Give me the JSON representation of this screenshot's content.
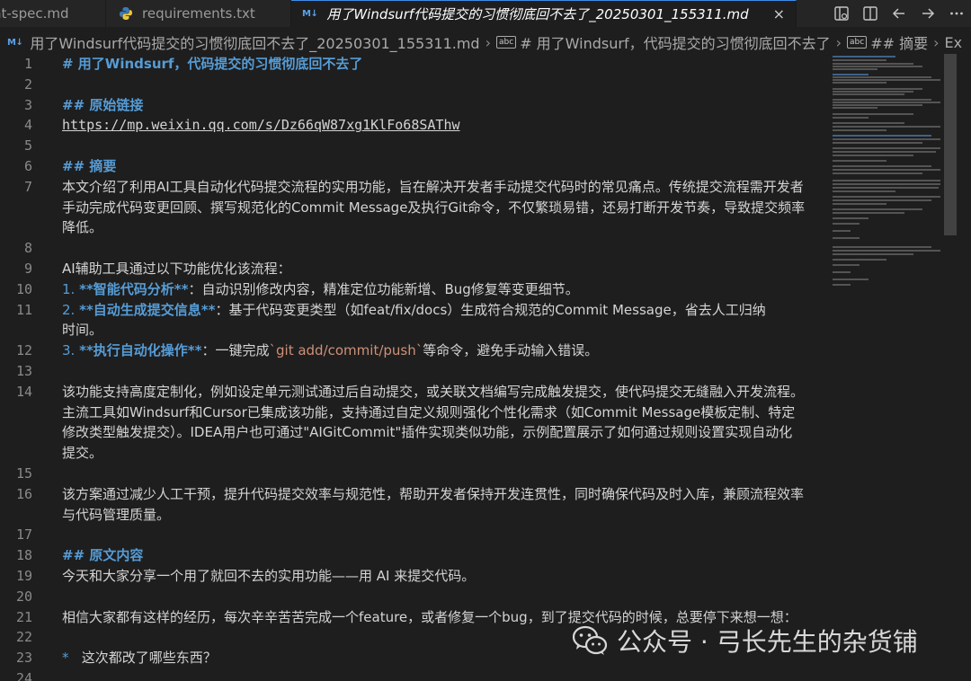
{
  "tabs": [
    {
      "label": "nt-spec.md",
      "type": "md"
    },
    {
      "label": "requirements.txt",
      "type": "py"
    },
    {
      "label": "用了Windsurf代码提交的习惯彻底回不去了_20250301_155311.md",
      "type": "md",
      "active": true,
      "close": "×"
    }
  ],
  "md_icon": "M↓",
  "breadcrumb": {
    "file": "用了Windsurf代码提交的习惯彻底回不去了_20250301_155311.md",
    "heading1": "# 用了Windsurf，代码提交的习惯彻底回不去了",
    "heading2": "## 摘要",
    "overflow": "Ex",
    "abc": "abc"
  },
  "lines": [
    {
      "n": "1",
      "parts": [
        {
          "t": "# 用了Windsurf，代码提交的习惯彻底回不去了",
          "c": "heading"
        }
      ]
    },
    {
      "n": "2",
      "parts": []
    },
    {
      "n": "3",
      "parts": [
        {
          "t": "## 原始链接",
          "c": "heading"
        }
      ]
    },
    {
      "n": "4",
      "parts": [
        {
          "t": "https://mp.weixin.qq.com/s/Dz66qW87xg1KlFo68SAThw",
          "c": "link"
        }
      ]
    },
    {
      "n": "5",
      "parts": []
    },
    {
      "n": "6",
      "parts": [
        {
          "t": "## 摘要",
          "c": "heading"
        }
      ]
    },
    {
      "n": "7",
      "parts": [
        {
          "t": "本文介绍了利用AI工具自动化代码提交流程的实用功能，旨在解决开发者手动提交代码时的常见痛点。传统提交流程需开发者",
          "c": ""
        }
      ]
    },
    {
      "n": "",
      "parts": [
        {
          "t": "手动完成代码变更回顾、撰写规范化的Commit Message及执行Git命令，不仅繁琐易错，还易打断开发节奏，导致提交频率",
          "c": ""
        }
      ]
    },
    {
      "n": "",
      "parts": [
        {
          "t": "降低。",
          "c": ""
        }
      ]
    },
    {
      "n": "8",
      "parts": []
    },
    {
      "n": "9",
      "parts": [
        {
          "t": "AI辅助工具通过以下功能优化该流程：",
          "c": ""
        }
      ]
    },
    {
      "n": "10",
      "parts": [
        {
          "t": "1. ",
          "c": "listnum"
        },
        {
          "t": "**智能代码分析**",
          "c": "bold"
        },
        {
          "t": "：自动识别修改内容，精准定位功能新增、Bug修复等变更细节。",
          "c": ""
        }
      ]
    },
    {
      "n": "11",
      "parts": [
        {
          "t": "2. ",
          "c": "listnum"
        },
        {
          "t": "**自动生成提交信息**",
          "c": "bold"
        },
        {
          "t": "：基于代码变更类型（如feat/fix/docs）生成符合规范的Commit Message，省去人工归纳",
          "c": ""
        }
      ]
    },
    {
      "n": "",
      "parts": [
        {
          "t": "时间。",
          "c": ""
        }
      ]
    },
    {
      "n": "12",
      "parts": [
        {
          "t": "3. ",
          "c": "listnum"
        },
        {
          "t": "**执行自动化操作**",
          "c": "bold"
        },
        {
          "t": "：一键完成",
          "c": ""
        },
        {
          "t": "`git add/commit/push`",
          "c": "codetick"
        },
        {
          "t": "等命令，避免手动输入错误。",
          "c": ""
        }
      ]
    },
    {
      "n": "13",
      "parts": []
    },
    {
      "n": "14",
      "parts": [
        {
          "t": "该功能支持高度定制化，例如设定单元测试通过后自动提交，或关联文档编写完成触发提交，使代码提交无缝融入开发流程。",
          "c": ""
        }
      ]
    },
    {
      "n": "",
      "parts": [
        {
          "t": "主流工具如Windsurf和Cursor已集成该功能，支持通过自定义规则强化个性化需求（如Commit Message模板定制、特定",
          "c": ""
        }
      ]
    },
    {
      "n": "",
      "parts": [
        {
          "t": "修改类型触发提交）。IDEA用户也可通过\"AIGitCommit\"插件实现类似功能，示例配置展示了如何通过规则设置实现自动化",
          "c": ""
        }
      ]
    },
    {
      "n": "",
      "parts": [
        {
          "t": "提交。",
          "c": ""
        }
      ]
    },
    {
      "n": "15",
      "parts": []
    },
    {
      "n": "16",
      "parts": [
        {
          "t": "该方案通过减少人工干预，提升代码提交效率与规范性，帮助开发者保持开发连贯性，同时确保代码及时入库，兼顾流程效率",
          "c": ""
        }
      ]
    },
    {
      "n": "",
      "parts": [
        {
          "t": "与代码管理质量。",
          "c": ""
        }
      ]
    },
    {
      "n": "17",
      "parts": []
    },
    {
      "n": "18",
      "parts": [
        {
          "t": "## 原文内容",
          "c": "heading"
        }
      ]
    },
    {
      "n": "19",
      "parts": [
        {
          "t": "今天和大家分享一个用了就回不去的实用功能——用 AI 来提交代码。",
          "c": ""
        }
      ]
    },
    {
      "n": "20",
      "parts": []
    },
    {
      "n": "21",
      "parts": [
        {
          "t": "相信大家都有这样的经历，每次辛辛苦苦完成一个feature，或者修复一个bug，到了提交代码的时候，总要停下来想一想：",
          "c": ""
        }
      ]
    },
    {
      "n": "22",
      "parts": []
    },
    {
      "n": "23",
      "parts": [
        {
          "t": "*",
          "c": "bullet"
        },
        {
          "t": "   这次都改了哪些东西？",
          "c": ""
        }
      ]
    },
    {
      "n": "24",
      "parts": []
    }
  ],
  "watermark": {
    "text": "公众号 · 弓长先生的杂货铺"
  },
  "colors": {
    "accent": "#569cd6",
    "background": "#1e1e1e",
    "code": "#ce9178"
  }
}
